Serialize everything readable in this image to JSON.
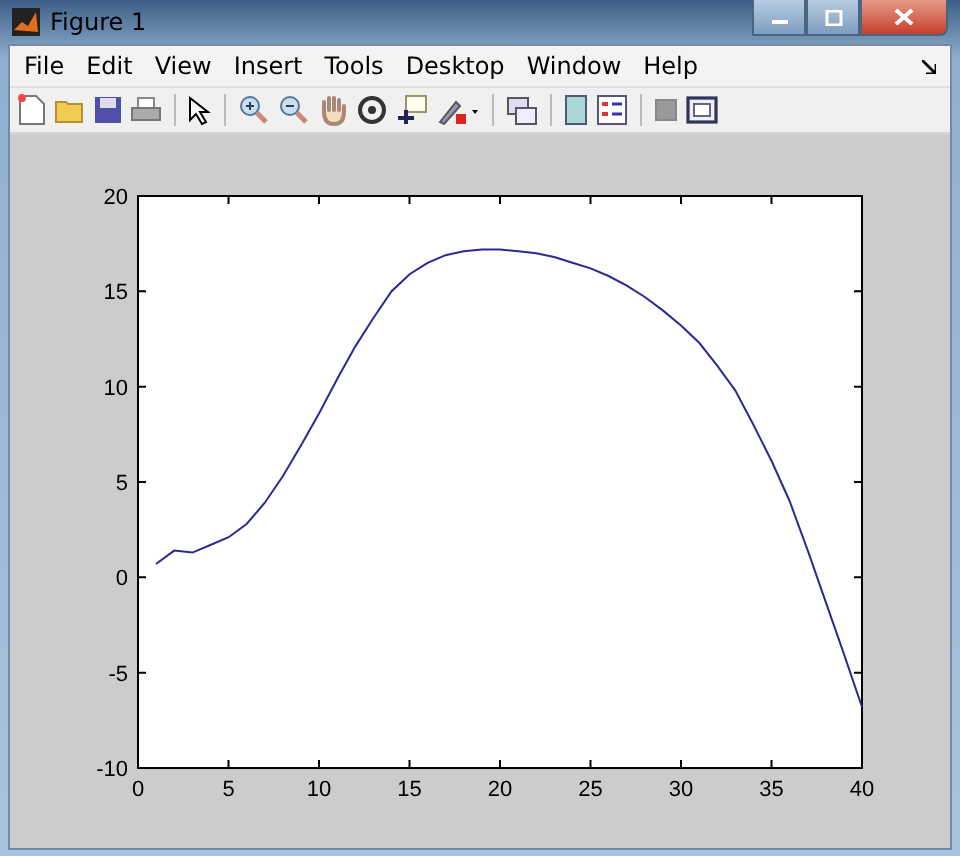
{
  "window": {
    "title": "Figure 1"
  },
  "menu": [
    "File",
    "Edit",
    "View",
    "Insert",
    "Tools",
    "Desktop",
    "Window",
    "Help"
  ],
  "figure": {
    "chart_data": {
      "type": "line",
      "x": [
        1,
        2,
        3,
        4,
        5,
        6,
        7,
        8,
        9,
        10,
        11,
        12,
        13,
        14,
        15,
        16,
        17,
        18,
        19,
        20,
        21,
        22,
        23,
        24,
        25,
        26,
        27,
        28,
        29,
        30,
        31,
        32,
        33,
        34,
        35,
        36,
        37,
        38,
        39,
        40
      ],
      "series": [
        {
          "color": "#2a2a96",
          "values": [
            0.7,
            1.4,
            1.3,
            1.7,
            2.1,
            2.8,
            3.9,
            5.3,
            6.9,
            8.6,
            10.4,
            12.1,
            13.6,
            15.0,
            15.9,
            16.5,
            16.9,
            17.1,
            17.2,
            17.2,
            17.1,
            17.0,
            16.8,
            16.5,
            16.2,
            15.8,
            15.3,
            14.7,
            14.0,
            13.2,
            12.3,
            11.1,
            9.8,
            8.0,
            6.1,
            4.0,
            1.4,
            -1.3,
            -4.0,
            -6.8
          ]
        }
      ],
      "xlim": [
        0,
        40
      ],
      "ylim": [
        -10,
        20
      ],
      "xticks": [
        0,
        5,
        10,
        15,
        20,
        25,
        30,
        35,
        40
      ],
      "yticks": [
        -10,
        -5,
        0,
        5,
        10,
        15,
        20
      ]
    }
  }
}
